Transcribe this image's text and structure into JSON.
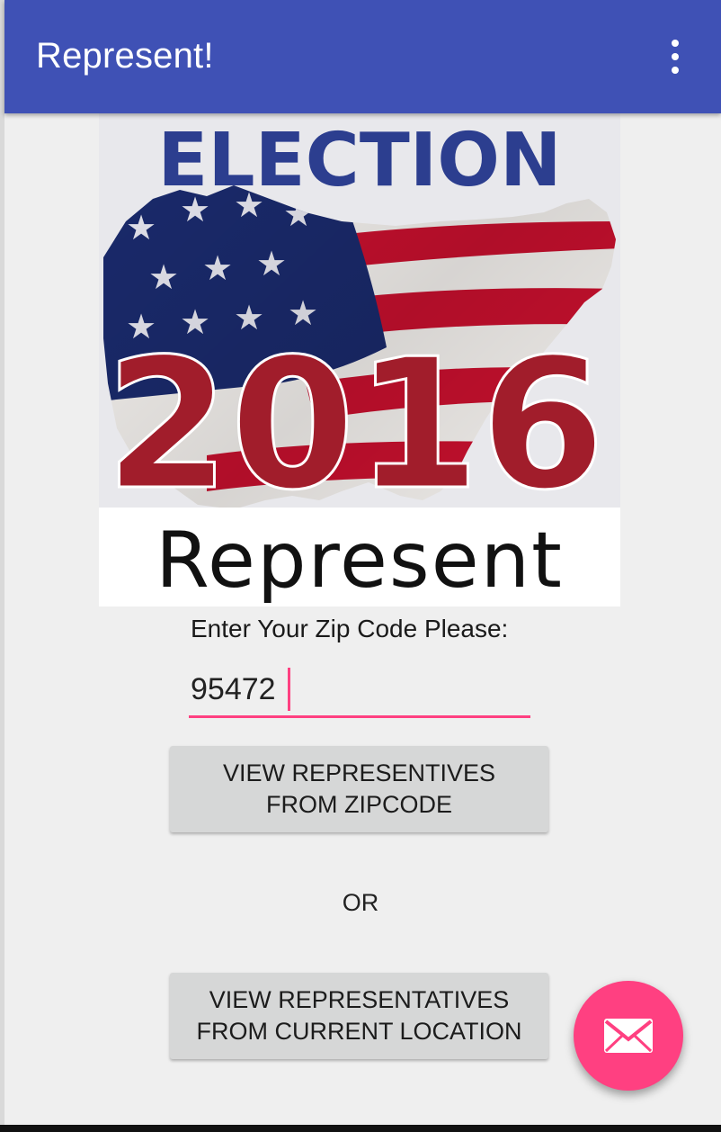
{
  "app_bar": {
    "title": "Represent!",
    "background_color": "#3f51b5",
    "overflow_icon": "more-vertical-icon"
  },
  "hero": {
    "heading": "ELECTION",
    "year": "2016",
    "wordmark": "Represent"
  },
  "zip": {
    "label": "Enter Your Zip Code Please:",
    "value": "95472",
    "accent_color": "#ff4081"
  },
  "buttons": {
    "zip_label": "VIEW REPRESENTIVES\nFROM ZIPCODE",
    "location_label": "VIEW REPRESENTATIVES\nFROM CURRENT LOCATION"
  },
  "separator": "OR",
  "fab": {
    "icon": "mail-icon",
    "color": "#ff4081"
  }
}
